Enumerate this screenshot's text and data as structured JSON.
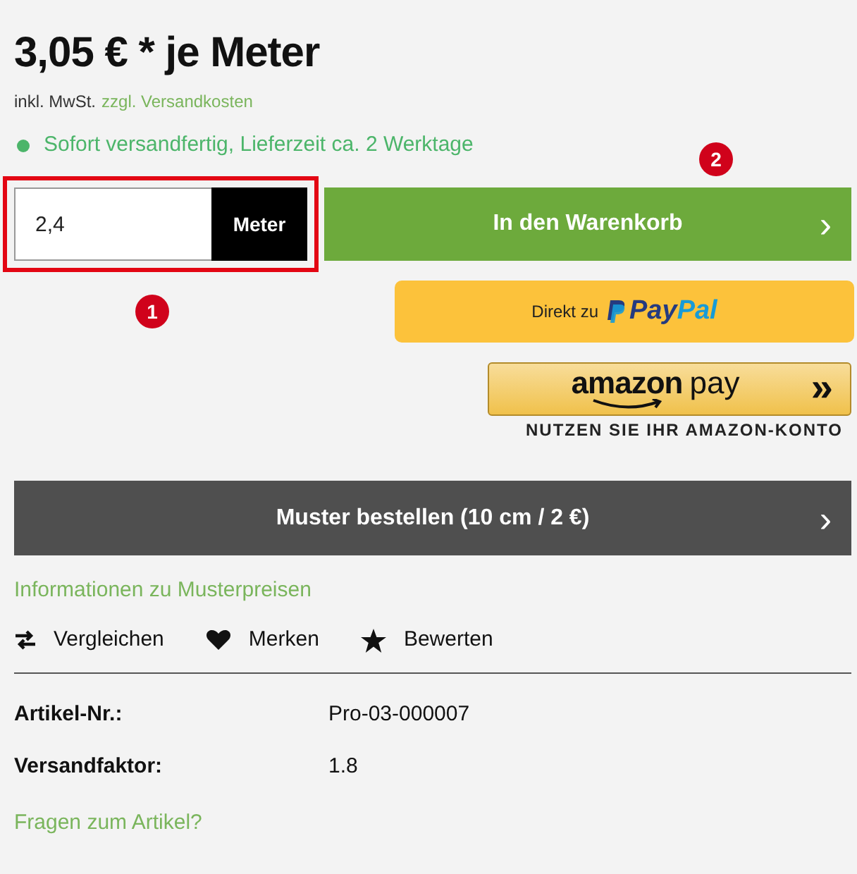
{
  "price": "3,05 € * je Meter",
  "tax_note": {
    "text": "inkl. MwSt.",
    "shipping_link": "zzgl. Versandkosten"
  },
  "availability": {
    "text": "Sofort versandfertig, Lieferzeit ca. 2 Werktage",
    "color": "#4cb56a"
  },
  "quantity": {
    "value": "2,4",
    "unit": "Meter",
    "highlighted": true
  },
  "cart_button": {
    "label": "In den Warenkorb",
    "chevron": "›"
  },
  "paypal_button": {
    "prefix": "Direkt zu",
    "brand_parts": [
      "Pay",
      "Pal"
    ]
  },
  "amazon_pay_button": {
    "brand_parts": [
      "amazon",
      "pay"
    ],
    "arrows": "»",
    "caption": "NUTZEN SIE IHR AMAZON-KONTO"
  },
  "sample_button": {
    "label": "Muster bestellen (10 cm / 2 €)",
    "chevron": "›"
  },
  "sample_info_link": "Informationen zu Musterpreisen",
  "actions": [
    {
      "kind": "compare",
      "label": "Vergleichen"
    },
    {
      "kind": "wishlist",
      "label": "Merken"
    },
    {
      "kind": "rate",
      "label": "Bewerten"
    }
  ],
  "details": [
    {
      "label": "Artikel-Nr.:",
      "value": "Pro-03-000007"
    },
    {
      "label": "Versandfaktor:",
      "value": "1.8"
    }
  ],
  "question_link": "Fragen zum Artikel?",
  "annotations": [
    {
      "label": "1",
      "kind": "quantity"
    },
    {
      "label": "2",
      "kind": "cart"
    }
  ]
}
